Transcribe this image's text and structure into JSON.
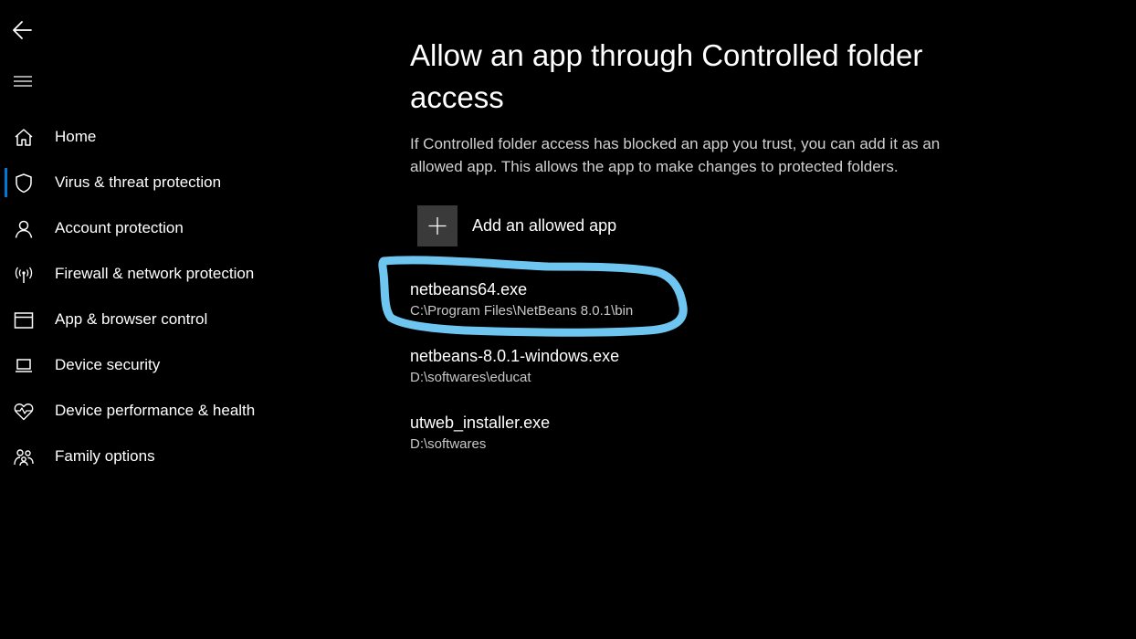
{
  "nav": {
    "back_icon": "arrow-left-icon",
    "menu_icon": "hamburger-menu-icon",
    "items": [
      {
        "label": "Home",
        "icon": "home-icon"
      },
      {
        "label": "Virus & threat protection",
        "icon": "shield-icon",
        "selected": true
      },
      {
        "label": "Account protection",
        "icon": "person-icon"
      },
      {
        "label": "Firewall & network protection",
        "icon": "antenna-icon"
      },
      {
        "label": "App & browser control",
        "icon": "browser-window-icon"
      },
      {
        "label": "Device security",
        "icon": "laptop-icon"
      },
      {
        "label": "Device performance & health",
        "icon": "heart-pulse-icon"
      },
      {
        "label": "Family options",
        "icon": "family-icon"
      }
    ]
  },
  "main": {
    "title": "Allow an app through Controlled folder access",
    "description": "If Controlled folder access has blocked an app you trust, you can add it as an allowed app. This allows the app to make changes to protected folders.",
    "add_button_label": "Add an allowed app",
    "add_icon": "plus-icon",
    "allowed_apps": [
      {
        "name": "netbeans64.exe",
        "path": "C:\\Program Files\\NetBeans 8.0.1\\bin"
      },
      {
        "name": "netbeans-8.0.1-windows.exe",
        "path": "D:\\softwares\\educat"
      },
      {
        "name": "utweb_installer.exe",
        "path": "D:\\softwares"
      }
    ]
  },
  "colors": {
    "background": "#000000",
    "accent": "#0078d7",
    "annotation": "#6ec6f0",
    "button_bg": "#3a3a3a"
  }
}
